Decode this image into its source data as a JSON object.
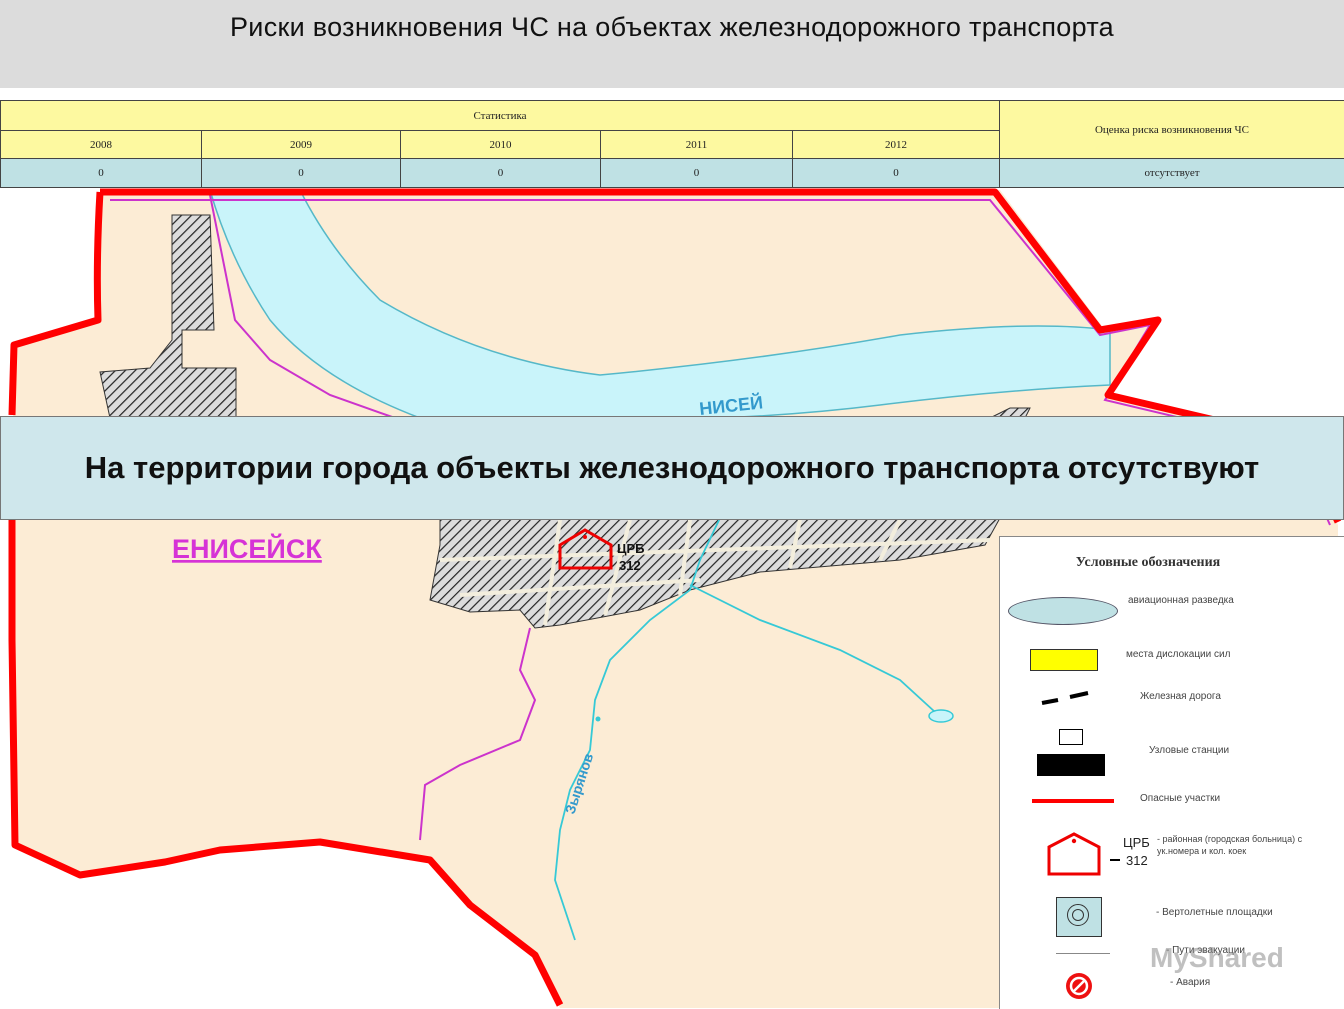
{
  "title": "Риски возникновения ЧС на объектах железнодорожного транспорта",
  "stats_table": {
    "group_header": "Статистика",
    "risk_header": "Оценка риска возникновения ЧС",
    "years": [
      "2008",
      "2009",
      "2010",
      "2011",
      "2012"
    ],
    "values": [
      "0",
      "0",
      "0",
      "0",
      "0"
    ],
    "risk_value": "отсутствует"
  },
  "map": {
    "city_label": "ЕНИСЕЙСК",
    "river_label": "НИСЕЙ",
    "stream_label": "Зырянов",
    "hospital_label": "ЦРБ",
    "hospital_beds": "312",
    "colors": {
      "land": "#fcecd5",
      "water": "#c9f4fa",
      "danger": "#ff0000",
      "boundary": "#cc33cc",
      "city_label": "#d633d6"
    }
  },
  "banner": "На территории города объекты железнодорожного транспорта отсутствуют",
  "legend": {
    "title": "Условные обозначения",
    "items": {
      "aviation": "авиационная разведка",
      "forces": "места дислокации сил",
      "railway": "Железная дорога",
      "stations": "Узловые станции",
      "danger": "Опасные участки",
      "hospital_abbr": "ЦРБ",
      "hospital_num": "312",
      "hospital_desc": "- районная (городская больница) с ук.номера и кол. коек",
      "heliport": "- Вертолетные площадки",
      "evacuation": "- Пути эвакуации",
      "accident": "- Авария"
    }
  },
  "watermark": "MyShared"
}
